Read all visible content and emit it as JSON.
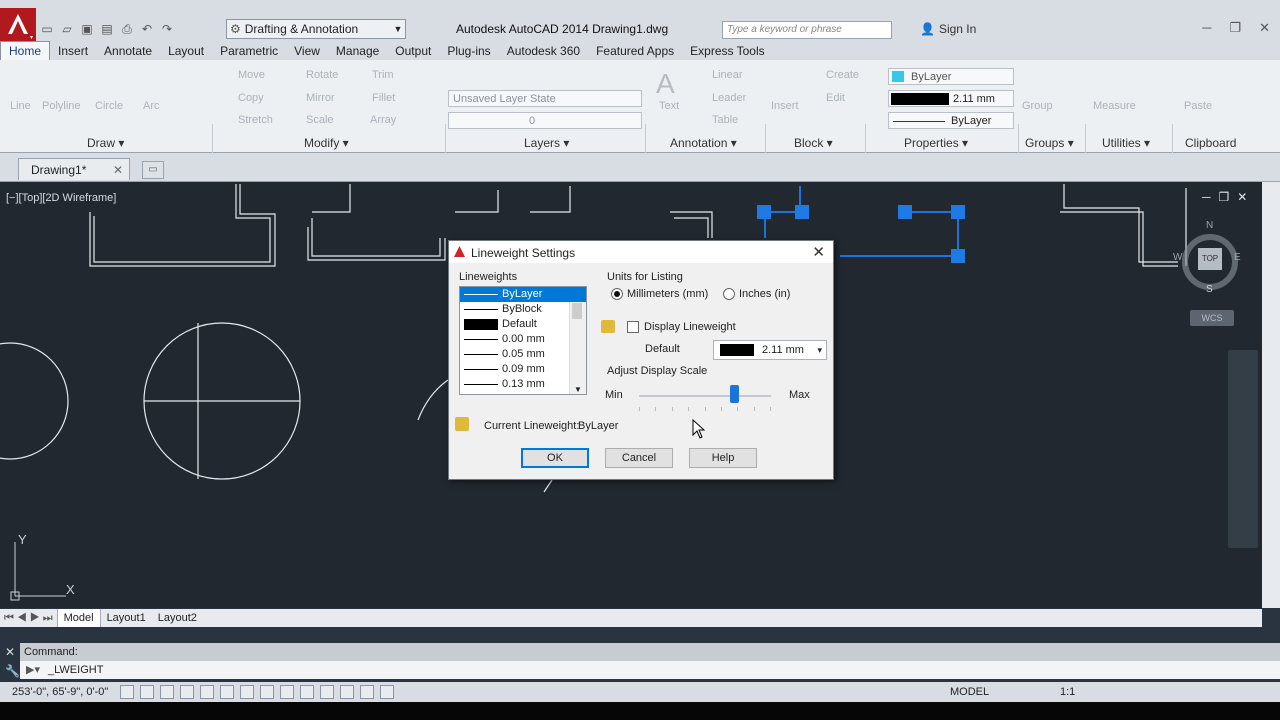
{
  "window": {
    "workspace": "Drafting & Annotation",
    "title": "Autodesk AutoCAD 2014    Drawing1.dwg",
    "search_placeholder": "Type a keyword or phrase",
    "sign_in": "Sign In"
  },
  "ribbon_tabs": [
    "Home",
    "Insert",
    "Annotate",
    "Layout",
    "Parametric",
    "View",
    "Manage",
    "Output",
    "Plug-ins",
    "Autodesk 360",
    "Featured Apps",
    "Express Tools"
  ],
  "ribbon": {
    "draw": {
      "tools": [
        "Line",
        "Polyline",
        "Circle",
        "Arc"
      ],
      "label": "Draw"
    },
    "modify": {
      "tools": [
        "Move",
        "Rotate",
        "Trim",
        "Copy",
        "Mirror",
        "Fillet",
        "Stretch",
        "Scale",
        "Array"
      ],
      "label": "Modify"
    },
    "layers": {
      "layer_state": "Unsaved Layer State",
      "layer_name": "0",
      "label": "Layers"
    },
    "annotation": {
      "tools": [
        "Text",
        "Linear",
        "Leader",
        "Table"
      ],
      "label": "Annotation"
    },
    "block": {
      "tools": [
        "Insert",
        "Create",
        "Edit"
      ],
      "label": "Block"
    },
    "properties": {
      "color": "ByLayer",
      "lineweight": "2.11 mm",
      "linetype": "ByLayer",
      "label": "Properties"
    },
    "groups": {
      "tools": [
        "Group"
      ],
      "label": "Groups"
    },
    "utilities": {
      "tools": [
        "Measure"
      ],
      "label": "Utilities"
    },
    "clipboard": {
      "tools": [
        "Paste"
      ],
      "label": "Clipboard"
    }
  },
  "document_tab": "Drawing1*",
  "viewport_label": "[−][Top][2D Wireframe]",
  "viewcube": {
    "n": "N",
    "s": "S",
    "e": "E",
    "w": "W",
    "top": "TOP",
    "wcs": "WCS"
  },
  "ucs": {
    "x": "X",
    "y": "Y"
  },
  "layout_tabs": [
    "Model",
    "Layout1",
    "Layout2"
  ],
  "command": {
    "history": "Command:",
    "current": "_LWEIGHT"
  },
  "status": {
    "coords": "253'-0\", 65'-9\", 0'-0\"",
    "space": "MODEL",
    "scale": "1:1"
  },
  "dialog": {
    "title": "Lineweight Settings",
    "lineweights_label": "Lineweights",
    "lineweights": [
      {
        "label": "ByLayer",
        "weight": 0.25,
        "selected": true
      },
      {
        "label": "ByBlock",
        "weight": 0.25,
        "selected": false
      },
      {
        "label": "Default",
        "weight": 2.11,
        "selected": false
      },
      {
        "label": "0.00 mm",
        "weight": 0.0,
        "selected": false
      },
      {
        "label": "0.05 mm",
        "weight": 0.05,
        "selected": false
      },
      {
        "label": "0.09 mm",
        "weight": 0.09,
        "selected": false
      },
      {
        "label": "0.13 mm",
        "weight": 0.13,
        "selected": false
      }
    ],
    "units_label": "Units for Listing",
    "unit_mm": "Millimeters (mm)",
    "unit_in": "Inches (in)",
    "unit_selected": "mm",
    "display_lineweight": "Display Lineweight",
    "display_checked": false,
    "default_label": "Default",
    "default_value": "2.11 mm",
    "scale_label": "Adjust Display Scale",
    "scale_min": "Min",
    "scale_max": "Max",
    "scale_position": 0.72,
    "current_label": "Current Lineweight:",
    "current_value": "ByLayer",
    "ok": "OK",
    "cancel": "Cancel",
    "help": "Help"
  },
  "colors": {
    "canvas_bg": "#212830",
    "selection": "#1a74d9",
    "grip": "#1e7be6",
    "title_red": "#d2232a"
  }
}
